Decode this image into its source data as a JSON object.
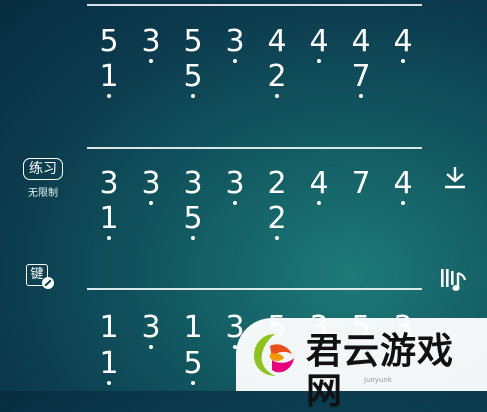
{
  "left_panel": {
    "practice_label": "练习",
    "practice_sub": "无限制",
    "keyboard_icon_glyph": "键"
  },
  "right_panel": {
    "download_icon": "download-icon",
    "score_icon": "score-icon"
  },
  "score": {
    "rows": [
      {
        "top": [
          "5",
          "3",
          "5",
          "3",
          "4",
          "4",
          "4",
          "4"
        ],
        "bottom": [
          "1",
          "",
          "5",
          "",
          "2",
          "",
          "7",
          ""
        ]
      },
      {
        "top": [
          "3",
          "3",
          "3",
          "3",
          "2",
          "4",
          "7",
          "4"
        ],
        "bottom": [
          "1",
          "",
          "5",
          "",
          "2",
          "",
          "",
          ""
        ]
      },
      {
        "top": [
          "1",
          "3",
          "1",
          "3",
          "5",
          "3",
          "5",
          "3"
        ],
        "bottom": [
          "1",
          "",
          "5",
          "",
          "",
          "",
          "",
          ""
        ]
      }
    ]
  },
  "watermark": {
    "title": "君云游戏网",
    "subtitle": "junyunk"
  },
  "colors": {
    "background_dark": "#082c40",
    "background_mid": "#125a62",
    "background_light": "#1e7a78",
    "foreground": "#ffffff"
  }
}
